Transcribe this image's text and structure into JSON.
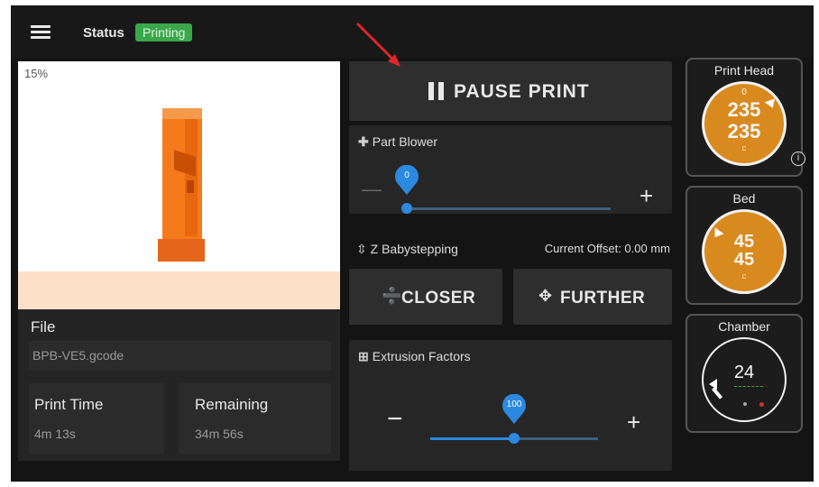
{
  "header": {
    "status_label": "Status",
    "status_value": "Printing",
    "status_color": "#3aa84a"
  },
  "preview": {
    "progress": "15%",
    "progress_value": 15
  },
  "job": {
    "file_label": "File",
    "file_name": "BPB-VE5.gcode",
    "print_time_label": "Print Time",
    "print_time": "4m 13s",
    "remaining_label": "Remaining",
    "remaining": "34m 56s"
  },
  "controls": {
    "pause_label": "PAUSE PRINT",
    "part_blower": {
      "title": "Part Blower",
      "value": "0",
      "value_num": 0,
      "minus": "—",
      "plus": "+"
    },
    "babystep": {
      "title": "Z Babystepping",
      "offset": "Current Offset: 0.00 mm",
      "closer": "CLOSER",
      "further": "FURTHER"
    },
    "extrusion": {
      "title": "Extrusion Factors",
      "value": "100",
      "value_num": 100,
      "minus": "−",
      "plus": "+"
    }
  },
  "temps": {
    "print_head": {
      "name": "Print Head",
      "top": "0",
      "current": "235",
      "target": "235",
      "unit": "c"
    },
    "bed": {
      "name": "Bed",
      "current": "45",
      "target": "45",
      "unit": "c"
    },
    "chamber": {
      "name": "Chamber",
      "current": "24"
    }
  },
  "icons": {
    "menu": "hamburger-icon",
    "pause": "pause-icon",
    "fan": "fan-icon",
    "babystep": "z-axis-icon",
    "extrusion": "extrusion-grid-icon",
    "info": "info-icon"
  },
  "colors": {
    "accent": "#2b89e0",
    "heater": "#d98a1f",
    "model": "#f47a1c",
    "annotation": "#e0262a"
  }
}
